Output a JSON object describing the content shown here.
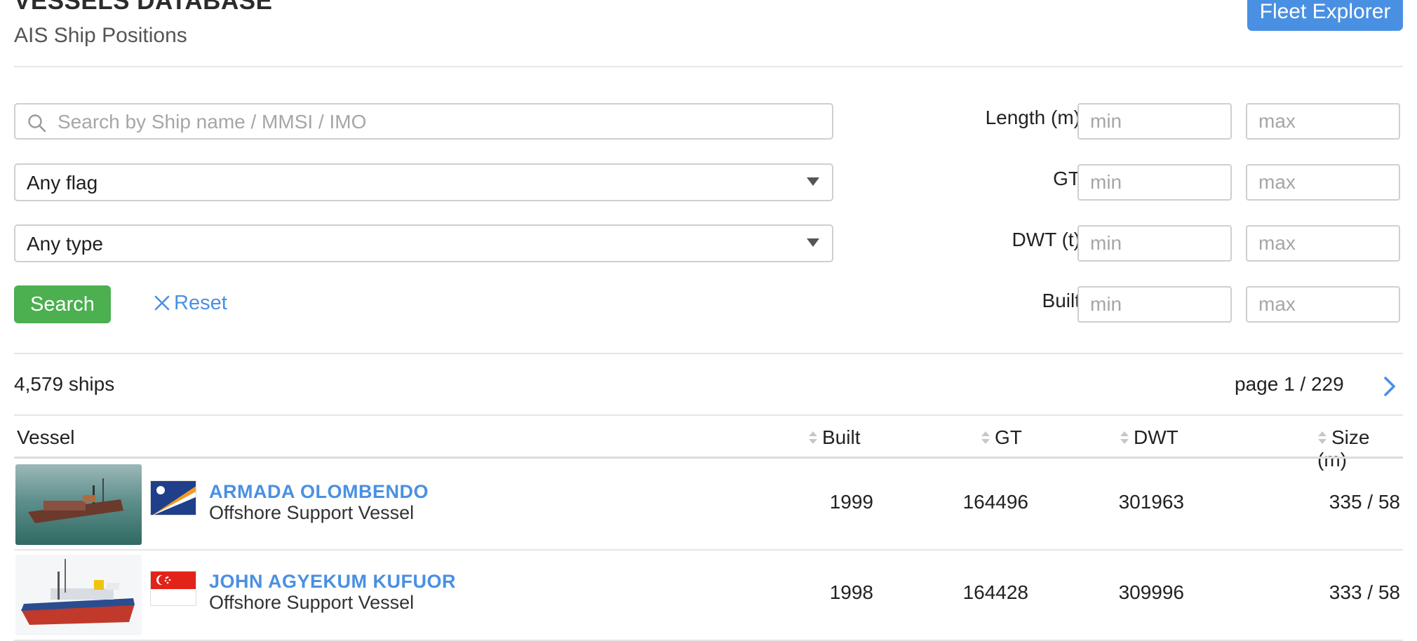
{
  "header": {
    "title": "VESSELS DATABASE",
    "subtitle": "AIS Ship Positions",
    "fleet_button": "Fleet Explorer"
  },
  "filters": {
    "search": {
      "placeholder": "Search by Ship name / MMSI / IMO",
      "value": ""
    },
    "flag_select": {
      "selected": "Any flag"
    },
    "type_select": {
      "selected": "Any type"
    },
    "search_button": "Search",
    "reset_button": "Reset",
    "ranges": [
      {
        "label": "Length (m)",
        "min_placeholder": "min",
        "max_placeholder": "max"
      },
      {
        "label": "GT",
        "min_placeholder": "min",
        "max_placeholder": "max"
      },
      {
        "label": "DWT (t)",
        "min_placeholder": "min",
        "max_placeholder": "max"
      },
      {
        "label": "Built",
        "min_placeholder": "min",
        "max_placeholder": "max"
      }
    ]
  },
  "results": {
    "count": "4,579 ships",
    "page_info": "page 1 / 229"
  },
  "table": {
    "columns": [
      "Vessel",
      "Built",
      "GT",
      "DWT",
      "Size (m)"
    ],
    "rows": [
      {
        "name": "ARMADA OLOMBENDO",
        "type": "Offshore Support Vessel",
        "built": "1999",
        "gt": "164496",
        "dwt": "301963",
        "size": "335 / 58",
        "flag": "marshall-islands"
      },
      {
        "name": "JOHN AGYEKUM KUFUOR",
        "type": "Offshore Support Vessel",
        "built": "1998",
        "gt": "164428",
        "dwt": "309996",
        "size": "333 / 58",
        "flag": "singapore"
      }
    ]
  },
  "colors": {
    "link_blue": "#4a90e2",
    "search_green": "#4caf50",
    "border_gray": "#cfcfcf"
  }
}
